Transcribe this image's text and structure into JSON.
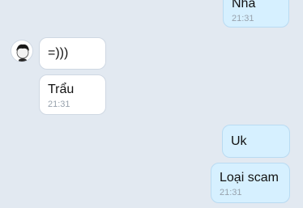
{
  "chat": {
    "messages": [
      {
        "text": "Nha",
        "time": "21:31"
      },
      {
        "text": "=)))"
      },
      {
        "text": "Trẩu",
        "time": "21:31"
      },
      {
        "text": "Uk"
      },
      {
        "text": "Loại scam",
        "time": "21:31"
      }
    ],
    "avatar_icon": "contact-avatar-icon"
  }
}
